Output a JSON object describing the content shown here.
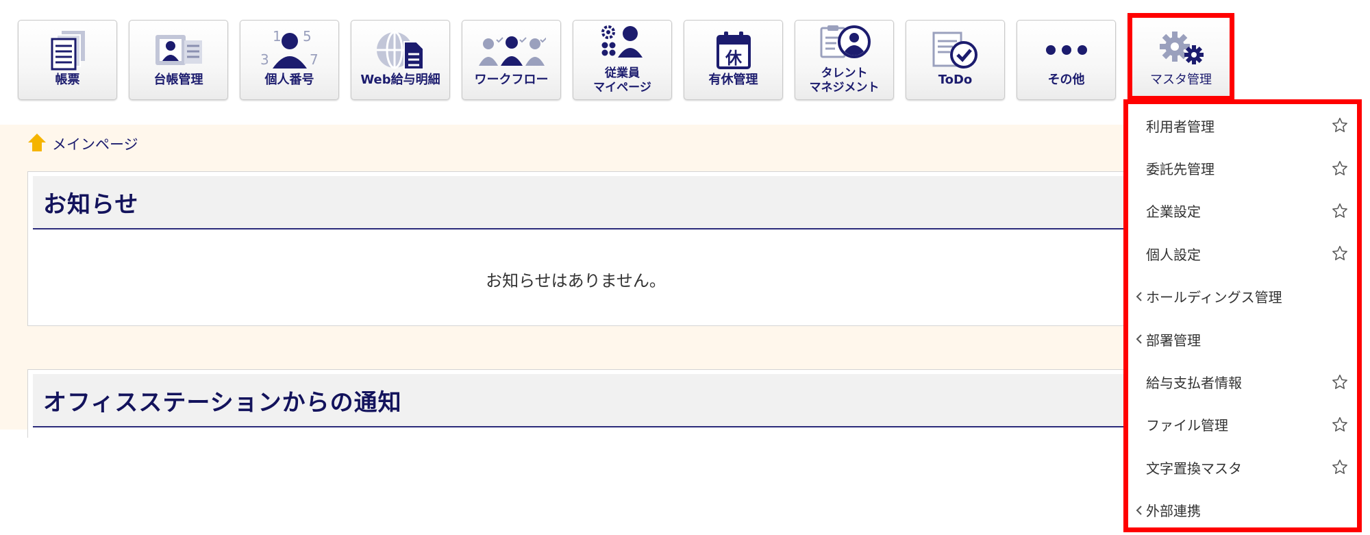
{
  "nav": {
    "items": [
      {
        "label": "帳票",
        "icon": "document-stack-icon"
      },
      {
        "label": "台帳管理",
        "icon": "id-card-icon"
      },
      {
        "label": "個人番号",
        "icon": "person-number-icon"
      },
      {
        "label": "Web給与明細",
        "icon": "web-payslip-icon"
      },
      {
        "label": "ワークフロー",
        "icon": "workflow-people-icon"
      },
      {
        "label_line1": "従業員",
        "label_line2": "マイページ",
        "icon": "employee-mypage-icon"
      },
      {
        "label": "有休管理",
        "icon": "calendar-leave-icon"
      },
      {
        "label_line1": "タレント",
        "label_line2": "マネジメント",
        "icon": "talent-clipboard-icon"
      },
      {
        "label": "ToDo",
        "icon": "todo-check-icon"
      },
      {
        "label": "その他",
        "icon": "more-dots-icon"
      },
      {
        "label": "マスタ管理",
        "icon": "gears-icon"
      }
    ],
    "calendar_glyph": "休",
    "number_digits": [
      "1",
      "5",
      "3",
      "7"
    ]
  },
  "breadcrumb": {
    "label": "メインページ"
  },
  "notices": {
    "title": "お知らせ",
    "empty_message": "お知らせはありません。"
  },
  "office_notices": {
    "title": "オフィスステーションからの通知"
  },
  "master_menu": {
    "items": [
      {
        "label": "利用者管理",
        "has_star": true,
        "has_submenu": false
      },
      {
        "label": "委託先管理",
        "has_star": true,
        "has_submenu": false
      },
      {
        "label": "企業設定",
        "has_star": true,
        "has_submenu": false
      },
      {
        "label": "個人設定",
        "has_star": true,
        "has_submenu": false
      },
      {
        "label": "ホールディングス管理",
        "has_star": false,
        "has_submenu": true
      },
      {
        "label": "部署管理",
        "has_star": false,
        "has_submenu": true
      },
      {
        "label": "給与支払者情報",
        "has_star": true,
        "has_submenu": false
      },
      {
        "label": "ファイル管理",
        "has_star": true,
        "has_submenu": false
      },
      {
        "label": "文字置換マスタ",
        "has_star": true,
        "has_submenu": false
      },
      {
        "label": "外部連携",
        "has_star": false,
        "has_submenu": true
      }
    ]
  },
  "colors": {
    "nav_text": "#1c1c6e",
    "highlight": "#ff0000",
    "content_background": "#fff7ec",
    "home_icon": "#f5b400"
  }
}
